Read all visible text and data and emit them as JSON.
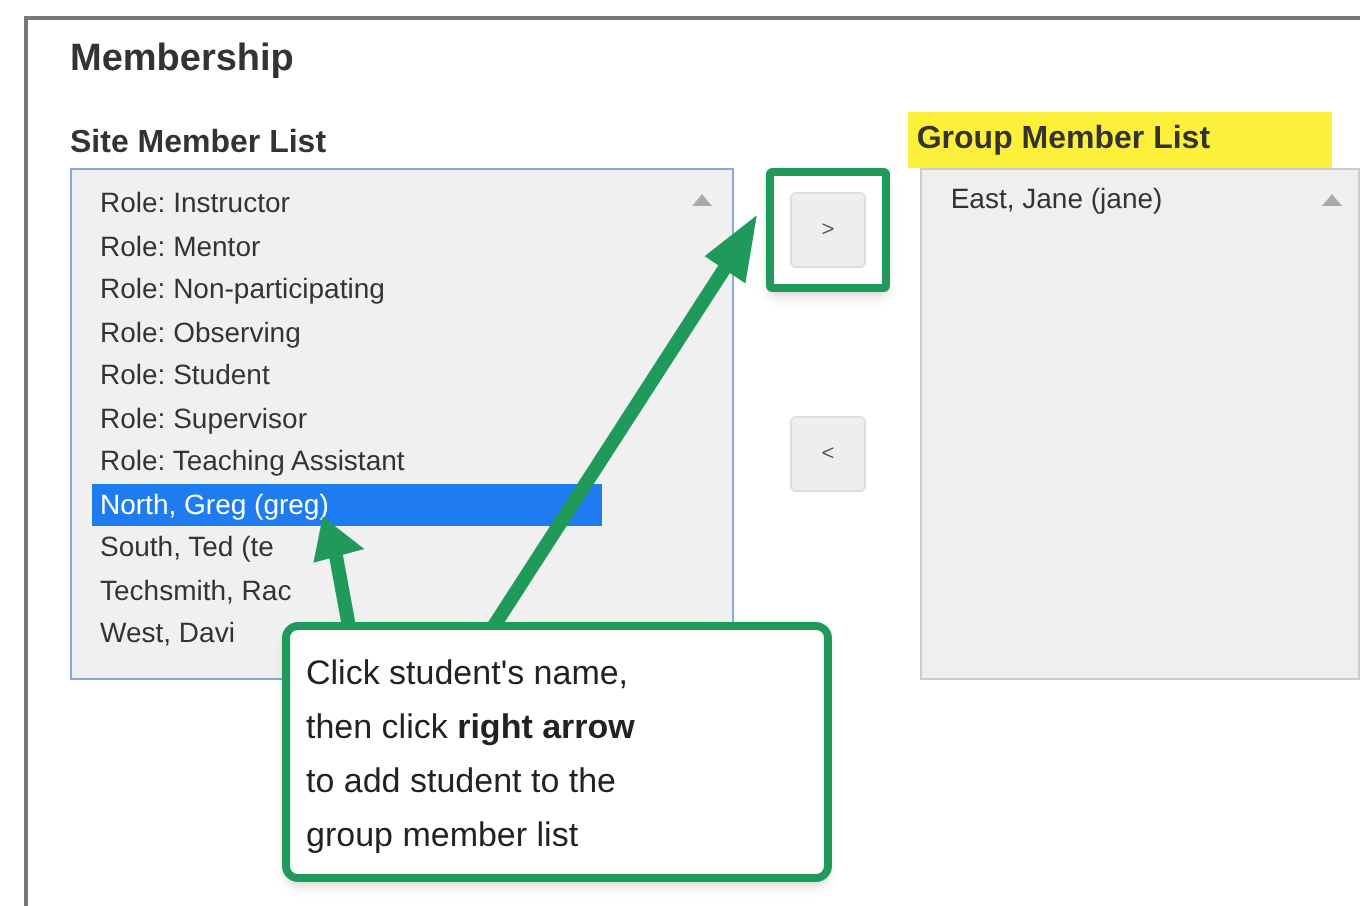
{
  "heading": "Membership",
  "site_list": {
    "title": "Site Member List",
    "items": [
      {
        "label": "Role: Instructor",
        "selected": false
      },
      {
        "label": "Role: Mentor",
        "selected": false
      },
      {
        "label": "Role: Non-participating",
        "selected": false
      },
      {
        "label": "Role: Observing",
        "selected": false
      },
      {
        "label": "Role: Student",
        "selected": false
      },
      {
        "label": "Role: Supervisor",
        "selected": false
      },
      {
        "label": "Role: Teaching Assistant",
        "selected": false
      },
      {
        "label": "North, Greg (greg)",
        "selected": true
      },
      {
        "label": "South, Ted (te",
        "selected": false
      },
      {
        "label": "Techsmith, Rac",
        "selected": false
      },
      {
        "label": "West, Davi",
        "selected": false
      }
    ]
  },
  "buttons": [
    {
      "label": ">",
      "highlighted": true
    },
    {
      "label": "<",
      "highlighted": false
    }
  ],
  "group_list": {
    "title": "Group Member List",
    "highlighted": true,
    "items": [
      {
        "label": "East, Jane (jane)",
        "selected": false
      }
    ]
  },
  "callout_lines": [
    "Click student's name,",
    "then click **right arrow**",
    "to add student to the",
    "group member list"
  ]
}
